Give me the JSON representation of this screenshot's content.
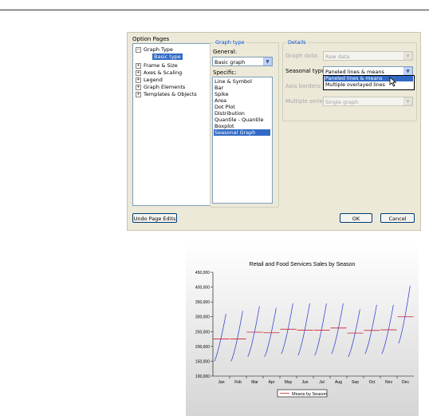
{
  "dialog": {
    "option_pages_label": "Option Pages",
    "tree": {
      "items": [
        {
          "label": "Graph Type",
          "expander": "−"
        },
        {
          "label": "Basic type",
          "selected": true
        },
        {
          "label": "Frame & Size",
          "expander": "+"
        },
        {
          "label": "Axes & Scaling",
          "expander": "+"
        },
        {
          "label": "Legend",
          "expander": "+"
        },
        {
          "label": "Graph Elements",
          "expander": "+"
        },
        {
          "label": "Templates & Objects",
          "expander": "+"
        }
      ]
    },
    "graph_type": {
      "title": "Graph type",
      "general_label": "General:",
      "general_value": "Basic graph",
      "specific_label": "Specific:",
      "specific_items": [
        "Line & Symbol",
        "Bar",
        "Spike",
        "Area",
        "Dot Plot",
        "Distribution",
        "Quantile - Quantile",
        "Boxplot",
        "Seasonal Graph"
      ],
      "specific_selected": "Seasonal Graph"
    },
    "details": {
      "title": "Details",
      "graph_data_label": "Graph data:",
      "graph_data_value": "Raw data",
      "seasonal_type_label": "Seasonal type:",
      "seasonal_type_value": "Paneled lines & means",
      "seasonal_type_options": [
        "Paneled lines & means",
        "Multiple overlayed lines"
      ],
      "axis_borders_label": "Axis borders:",
      "multiple_series_label": "Multiple series:",
      "multiple_series_value": "Single graph"
    },
    "buttons": {
      "undo": "Undo Page Edits",
      "ok": "OK",
      "cancel": "Cancel"
    }
  },
  "chart_data": {
    "type": "line",
    "title": "Retail and Food Services Sales by Season",
    "categories": [
      "Jan",
      "Feb",
      "Mar",
      "Apr",
      "May",
      "Jun",
      "Jul",
      "Aug",
      "Sep",
      "Oct",
      "Nov",
      "Dec"
    ],
    "ylim": [
      100000,
      450000
    ],
    "yticks": [
      100000,
      150000,
      200000,
      250000,
      300000,
      350000,
      400000,
      450000
    ],
    "ytick_labels": [
      "100,000",
      "150,000",
      "200,000",
      "250,000",
      "300,000",
      "350,000",
      "400,000",
      "450,000"
    ],
    "seasonal_lines": [
      {
        "start": 150000,
        "end": 310000
      },
      {
        "start": 150000,
        "end": 320000
      },
      {
        "start": 165000,
        "end": 335000
      },
      {
        "start": 165000,
        "end": 330000
      },
      {
        "start": 175000,
        "end": 345000
      },
      {
        "start": 170000,
        "end": 345000
      },
      {
        "start": 170000,
        "end": 345000
      },
      {
        "start": 175000,
        "end": 345000
      },
      {
        "start": 165000,
        "end": 325000
      },
      {
        "start": 175000,
        "end": 340000
      },
      {
        "start": 175000,
        "end": 340000
      },
      {
        "start": 210000,
        "end": 405000
      }
    ],
    "means": [
      225000,
      225000,
      248000,
      246000,
      258000,
      255000,
      255000,
      262000,
      245000,
      254000,
      256000,
      300000
    ],
    "series": [
      {
        "name": "Means by Season",
        "values": [
          225000,
          225000,
          248000,
          246000,
          258000,
          255000,
          255000,
          262000,
          245000,
          254000,
          256000,
          300000
        ]
      }
    ],
    "legend": "bottom-center",
    "colors": {
      "lines": "#2233cc",
      "means": "#cc2233"
    }
  }
}
